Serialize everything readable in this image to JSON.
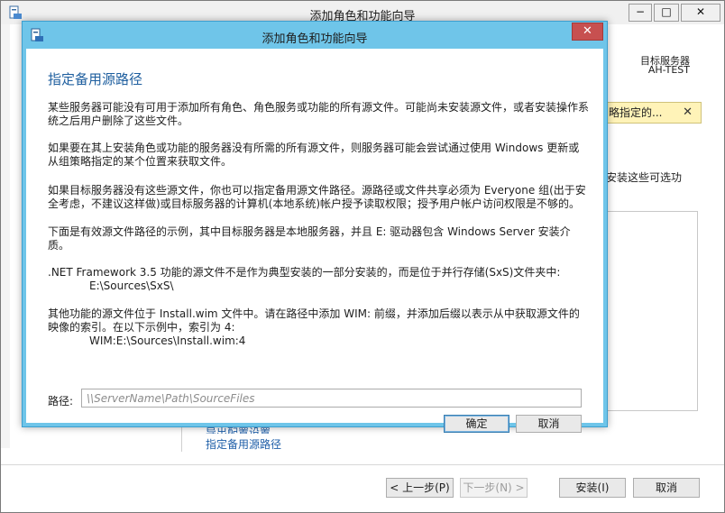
{
  "background": {
    "title": "添加角色和功能向导",
    "controls": {
      "min": "−",
      "max": "□",
      "close": "✕"
    },
    "destination_label": "目标服务器",
    "destination_server": "AH-TEST",
    "warning_text": "略指定的...",
    "warning_close": "✕",
    "cut_text": "安装这些可选功",
    "links": [
      "导出配置设置",
      "指定备用源路径"
    ],
    "buttons": {
      "prev": "< 上一步(P)",
      "next": "下一步(N) >",
      "install": "安装(I)",
      "cancel": "取消"
    }
  },
  "dialog": {
    "title": "添加角色和功能向导",
    "close": "✕",
    "heading": "指定备用源路径",
    "paragraphs": [
      "某些服务器可能没有可用于添加所有角色、角色服务或功能的所有源文件。可能尚未安装源文件，或者安装操作系统之后用户删除了这些文件。",
      "如果要在其上安装角色或功能的服务器没有所需的所有源文件，则服务器可能会尝试通过使用 Windows 更新或从组策略指定的某个位置来获取文件。",
      "如果目标服务器没有这些源文件，你也可以指定备用源文件路径。源路径或文件共享必须为 Everyone 组(出于安全考虑，不建议这样做)或目标服务器的计算机(本地系统)帐户授予读取权限；授予用户帐户访问权限是不够的。",
      "下面是有效源文件路径的示例，其中目标服务器是本地服务器，并且 E: 驱动器包含 Windows Server 安装介质。"
    ],
    "example1_text": ".NET Framework 3.5 功能的源文件不是作为典型安装的一部分安装的，而是位于并行存储(SxS)文件夹中:",
    "example1_path": "E:\\Sources\\SxS\\",
    "example2_text": "其他功能的源文件位于 Install.wim 文件中。请在路径中添加 WIM: 前缀，并添加后缀以表示从中获取源文件的映像的索引。在以下示例中，索引为 4:",
    "example2_path": "WIM:E:\\Sources\\Install.wim:4",
    "path_label": "路径:",
    "path_placeholder": "\\\\ServerName\\Path\\SourceFiles",
    "path_value": "",
    "ok": "确定",
    "cancel": "取消"
  }
}
